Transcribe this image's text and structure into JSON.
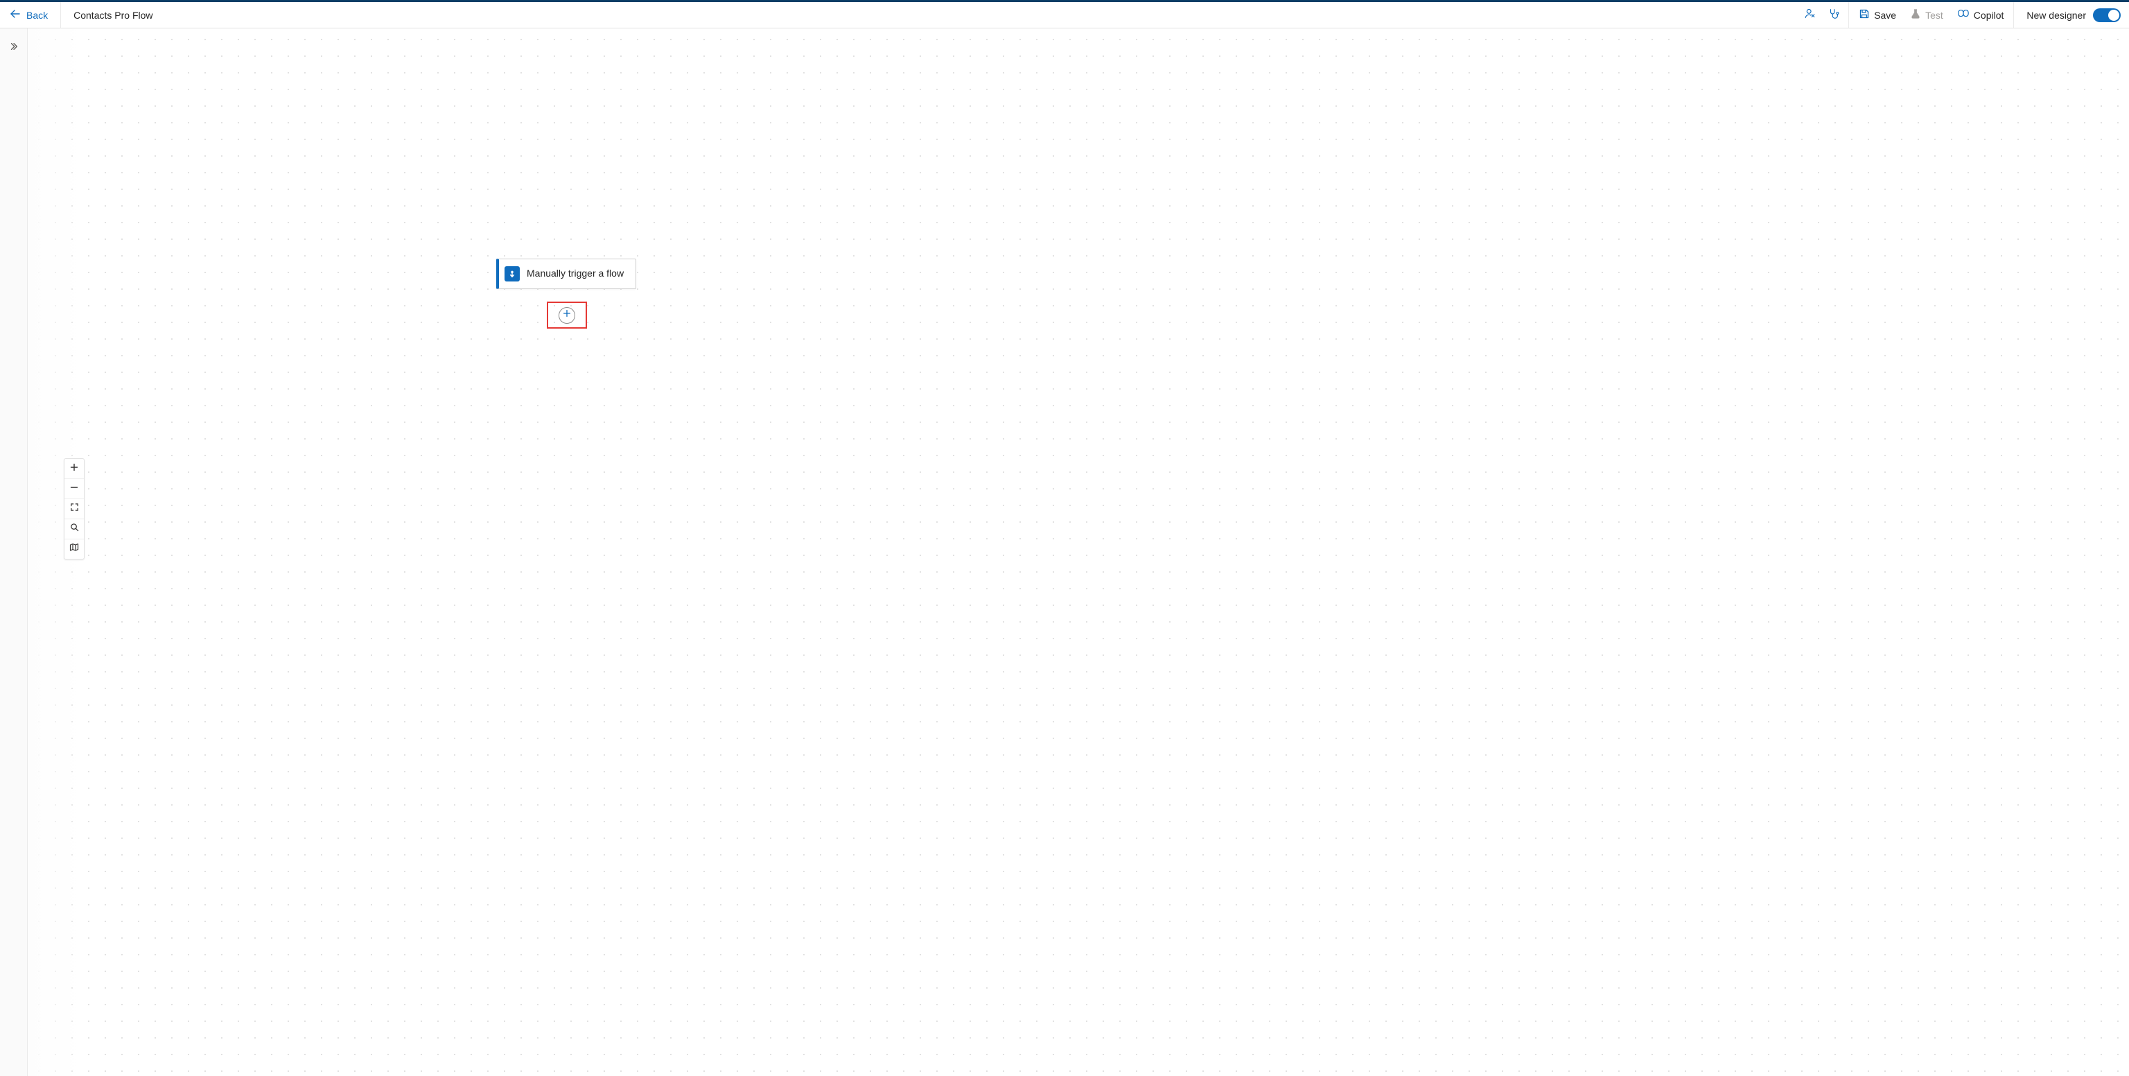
{
  "header": {
    "back_label": "Back",
    "flow_title": "Contacts Pro Flow",
    "save_label": "Save",
    "test_label": "Test",
    "copilot_label": "Copilot",
    "new_designer_label": "New designer",
    "new_designer_on": true,
    "icons": {
      "feedback": "feedback-icon",
      "diagnostics": "stethoscope-icon",
      "save": "save-icon",
      "test": "flask-icon",
      "copilot": "copilot-icon"
    }
  },
  "left_rail": {
    "expand_tooltip": "Expand"
  },
  "canvas": {
    "trigger": {
      "label": "Manually trigger a flow",
      "color": "#0F6CBD"
    },
    "add_step_tooltip": "Insert a new step"
  },
  "zoom": {
    "zoom_in_tooltip": "Zoom in",
    "zoom_out_tooltip": "Zoom out",
    "fit_tooltip": "Fit to screen",
    "search_tooltip": "Search",
    "minimap_tooltip": "Mini map"
  }
}
